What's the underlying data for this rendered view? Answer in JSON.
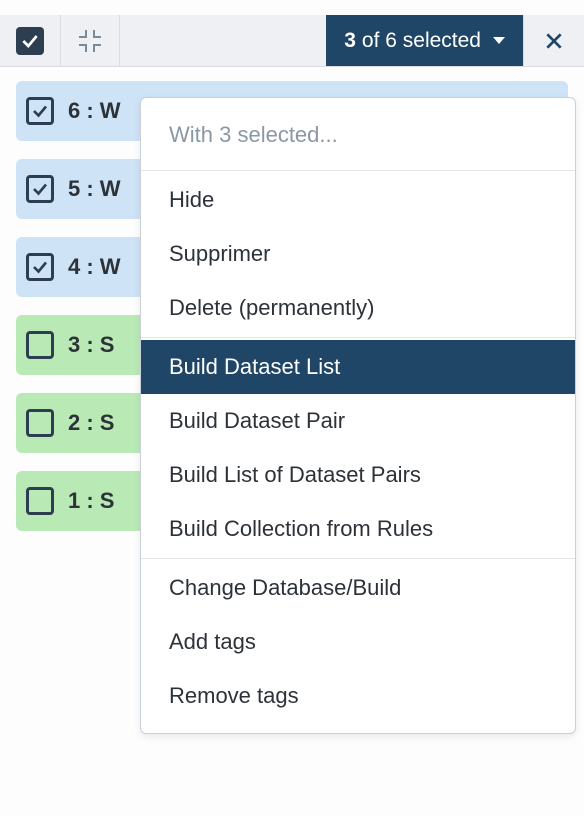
{
  "toolbar": {
    "selection_count": "3",
    "selection_suffix": "of 6 selected"
  },
  "items": [
    {
      "num": "6",
      "label": "6 : W",
      "checked": true,
      "state": "sel"
    },
    {
      "num": "5",
      "label": "5 : W",
      "checked": true,
      "state": "sel"
    },
    {
      "num": "4",
      "label": "4 : W",
      "checked": true,
      "state": "sel"
    },
    {
      "num": "3",
      "label": "3 : S",
      "checked": false,
      "state": "ok"
    },
    {
      "num": "2",
      "label": "2 : S",
      "checked": false,
      "state": "ok"
    },
    {
      "num": "1",
      "label": "1 : S",
      "checked": false,
      "state": "ok"
    }
  ],
  "menu": {
    "header": "With 3 selected...",
    "groups": [
      [
        {
          "label": "Hide",
          "active": false
        },
        {
          "label": "Supprimer",
          "active": false
        },
        {
          "label": "Delete (permanently)",
          "active": false
        }
      ],
      [
        {
          "label": "Build Dataset List",
          "active": true
        },
        {
          "label": "Build Dataset Pair",
          "active": false
        },
        {
          "label": "Build List of Dataset Pairs",
          "active": false
        },
        {
          "label": "Build Collection from Rules",
          "active": false
        }
      ],
      [
        {
          "label": "Change Database/Build",
          "active": false
        },
        {
          "label": "Add tags",
          "active": false
        },
        {
          "label": "Remove tags",
          "active": false
        }
      ]
    ]
  }
}
